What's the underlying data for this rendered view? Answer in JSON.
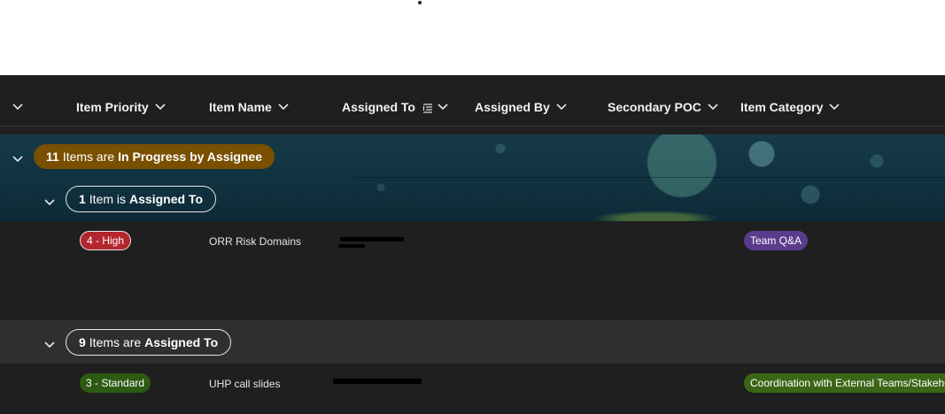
{
  "header": {
    "columns": [
      {
        "label": "Item Priority"
      },
      {
        "label": "Item Name"
      },
      {
        "label": "Assigned To"
      },
      {
        "label": "Assigned By"
      },
      {
        "label": "Secondary POC"
      },
      {
        "label": "Item Category"
      }
    ]
  },
  "groups": {
    "status": {
      "count": "11",
      "text": "Items are",
      "value": "In Progress by Assignee"
    },
    "sub1": {
      "count": "1",
      "text": "Item is",
      "value": "Assigned To"
    },
    "sub2": {
      "count": "9",
      "text": "Items are",
      "value": "Assigned To"
    }
  },
  "rows": [
    {
      "priority": "4 - High",
      "name": "ORR Risk Domains",
      "category": "Team Q&A"
    },
    {
      "priority": "3 - Standard",
      "name": "UHP call slides",
      "category": "Coordination with External Teams/Stakeho"
    }
  ],
  "colors": {
    "status_pill": "#7a4f00",
    "high_badge": "#b4262e",
    "standard_badge": "#2d5a12",
    "team_qa_badge": "#5b3c8c",
    "coordination_badge": "#3a6617"
  }
}
